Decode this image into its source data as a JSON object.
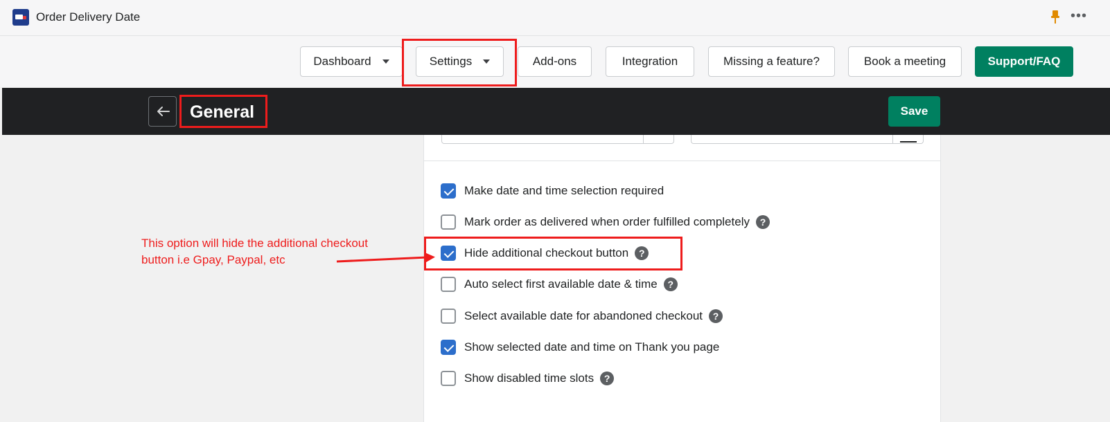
{
  "app": {
    "title": "Order Delivery Date"
  },
  "nav": [
    {
      "label": "Dashboard"
    },
    {
      "label": "Settings"
    },
    {
      "label": "Add-ons"
    },
    {
      "label": "Integration"
    },
    {
      "label": "Missing a feature?"
    },
    {
      "label": "Book a meeting"
    },
    {
      "label": "Support/FAQ"
    }
  ],
  "header": {
    "title": "General",
    "save_label": "Save"
  },
  "options": [
    {
      "label": "Make date and time selection required",
      "checked": true,
      "help": false
    },
    {
      "label": "Mark order as delivered when order fulfilled completely",
      "checked": false,
      "help": true
    },
    {
      "label": "Hide additional checkout button",
      "checked": true,
      "help": true
    },
    {
      "label": "Auto select first available date & time",
      "checked": false,
      "help": true
    },
    {
      "label": "Select available date for abandoned checkout",
      "checked": false,
      "help": true
    },
    {
      "label": "Show selected date and time on Thank you page",
      "checked": true,
      "help": false
    },
    {
      "label": "Show disabled time slots",
      "checked": false,
      "help": true
    }
  ],
  "annotation": {
    "line1": "This option will hide the additional checkout",
    "line2": "button i.e Gpay, Paypal, etc",
    "color": "#ee1c1c"
  },
  "colors": {
    "accent": "#008060",
    "checkbox": "#2c6ecb",
    "header_bg": "#202123"
  },
  "icons": {
    "help": "?"
  }
}
